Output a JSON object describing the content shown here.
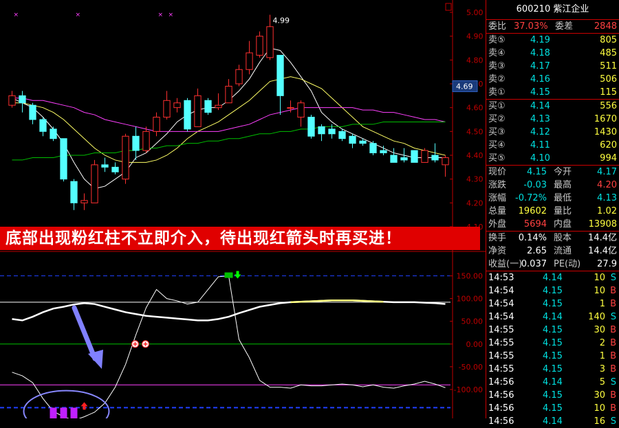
{
  "stock": {
    "code": "600210",
    "name": "紫江企业"
  },
  "banner_text": "底部出现粉红柱不立即介入，待出现红箭头时再买进！",
  "quote_top": {
    "weibi_label": "委比",
    "weibi": "37.03%",
    "weicha_label": "委差",
    "weicha": "2848"
  },
  "asks": [
    {
      "label": "卖⑤",
      "price": "4.19",
      "vol": "805"
    },
    {
      "label": "卖④",
      "price": "4.18",
      "vol": "485"
    },
    {
      "label": "卖③",
      "price": "4.17",
      "vol": "511"
    },
    {
      "label": "卖②",
      "price": "4.16",
      "vol": "506"
    },
    {
      "label": "卖①",
      "price": "4.15",
      "vol": "115"
    }
  ],
  "bids": [
    {
      "label": "买①",
      "price": "4.14",
      "vol": "556"
    },
    {
      "label": "买②",
      "price": "4.13",
      "vol": "1670"
    },
    {
      "label": "买③",
      "price": "4.12",
      "vol": "1430"
    },
    {
      "label": "买④",
      "price": "4.11",
      "vol": "620"
    },
    {
      "label": "买⑤",
      "price": "4.10",
      "vol": "994"
    }
  ],
  "stats": [
    {
      "l1": "现价",
      "v1": "4.15",
      "l2": "今开",
      "v2": "4.17"
    },
    {
      "l1": "涨跌",
      "v1": "-0.03",
      "l2": "最高",
      "v2": "4.20"
    },
    {
      "l1": "涨幅",
      "v1": "-0.72%",
      "l2": "最低",
      "v2": "4.13"
    },
    {
      "l1": "总量",
      "v1": "19602",
      "l2": "量比",
      "v2": "1.02"
    },
    {
      "l1": "外盘",
      "v1": "5694",
      "l2": "内盘",
      "v2": "13908"
    }
  ],
  "stats2": [
    {
      "l1": "换手",
      "v1": "0.14%",
      "l2": "股本",
      "v2": "14.4亿"
    },
    {
      "l1": "净资",
      "v1": "2.65",
      "l2": "流通",
      "v2": "14.4亿"
    },
    {
      "l1": "收益(一)",
      "v1": "0.037",
      "l2": "PE(动)",
      "v2": "27.9"
    }
  ],
  "ticks": [
    {
      "time": "14:53",
      "price": "4.14",
      "vol": "10",
      "side": "S"
    },
    {
      "time": "14:54",
      "price": "4.15",
      "vol": "10",
      "side": "B"
    },
    {
      "time": "14:54",
      "price": "4.15",
      "vol": "1",
      "side": "B"
    },
    {
      "time": "14:54",
      "price": "4.14",
      "vol": "140",
      "side": "S"
    },
    {
      "time": "14:55",
      "price": "4.15",
      "vol": "30",
      "side": "B"
    },
    {
      "time": "14:55",
      "price": "4.15",
      "vol": "2",
      "side": "B"
    },
    {
      "time": "14:55",
      "price": "4.15",
      "vol": "1",
      "side": "B"
    },
    {
      "time": "14:55",
      "price": "4.15",
      "vol": "3",
      "side": "B"
    },
    {
      "time": "14:56",
      "price": "4.14",
      "vol": "5",
      "side": "S"
    },
    {
      "time": "14:56",
      "price": "4.15",
      "vol": "30",
      "side": "B"
    },
    {
      "time": "14:56",
      "price": "4.15",
      "vol": "10",
      "side": "B"
    },
    {
      "time": "14:56",
      "price": "4.14",
      "vol": "16",
      "side": "S"
    }
  ],
  "colors": {
    "up": "#ff3030",
    "down": "#54ffff",
    "ma5": "#ffffff",
    "ma10": "#ffff66",
    "ma20": "#ff40ff",
    "ma60": "#00c000",
    "osc": "#ffffff",
    "grid": "#c00000"
  },
  "chart_data": [
    {
      "type": "candlestick",
      "ylim": [
        4.1,
        5.0
      ],
      "y_ticks": [
        "5.00",
        "4.90",
        "4.80",
        "4.70",
        "4.60",
        "4.50",
        "4.40",
        "4.30",
        "4.20",
        "4.10"
      ],
      "current_price_label": "4.69",
      "high_label": "4.99",
      "candles": [
        {
          "o": 4.61,
          "c": 4.65,
          "h": 4.67,
          "l": 4.6
        },
        {
          "o": 4.65,
          "c": 4.62,
          "h": 4.67,
          "l": 4.58
        },
        {
          "o": 4.61,
          "c": 4.55,
          "h": 4.62,
          "l": 4.53
        },
        {
          "o": 4.55,
          "c": 4.5,
          "h": 4.56,
          "l": 4.48
        },
        {
          "o": 4.51,
          "c": 4.47,
          "h": 4.52,
          "l": 4.46
        },
        {
          "o": 4.47,
          "c": 4.3,
          "h": 4.47,
          "l": 4.29
        },
        {
          "o": 4.29,
          "c": 4.2,
          "h": 4.3,
          "l": 4.17
        },
        {
          "o": 4.2,
          "c": 4.21,
          "h": 4.24,
          "l": 4.17
        },
        {
          "o": 4.2,
          "c": 4.36,
          "h": 4.38,
          "l": 4.2
        },
        {
          "o": 4.36,
          "c": 4.35,
          "h": 4.39,
          "l": 4.33
        },
        {
          "o": 4.35,
          "c": 4.33,
          "h": 4.37,
          "l": 4.32
        },
        {
          "o": 4.3,
          "c": 4.48,
          "h": 4.49,
          "l": 4.28
        },
        {
          "o": 4.48,
          "c": 4.42,
          "h": 4.52,
          "l": 4.38
        },
        {
          "o": 4.42,
          "c": 4.5,
          "h": 4.52,
          "l": 4.41
        },
        {
          "o": 4.5,
          "c": 4.56,
          "h": 4.58,
          "l": 4.48
        },
        {
          "o": 4.56,
          "c": 4.63,
          "h": 4.67,
          "l": 4.55
        },
        {
          "o": 4.6,
          "c": 4.62,
          "h": 4.64,
          "l": 4.58
        },
        {
          "o": 4.63,
          "c": 4.51,
          "h": 4.64,
          "l": 4.5
        },
        {
          "o": 4.52,
          "c": 4.65,
          "h": 4.68,
          "l": 4.52
        },
        {
          "o": 4.63,
          "c": 4.58,
          "h": 4.64,
          "l": 4.57
        },
        {
          "o": 4.6,
          "c": 4.61,
          "h": 4.66,
          "l": 4.59
        },
        {
          "o": 4.62,
          "c": 4.69,
          "h": 4.72,
          "l": 4.62
        },
        {
          "o": 4.7,
          "c": 4.76,
          "h": 4.78,
          "l": 4.69
        },
        {
          "o": 4.76,
          "c": 4.83,
          "h": 4.88,
          "l": 4.74
        },
        {
          "o": 4.82,
          "c": 4.9,
          "h": 4.92,
          "l": 4.81
        },
        {
          "o": 4.81,
          "c": 4.94,
          "h": 4.99,
          "l": 4.8
        },
        {
          "o": 4.82,
          "c": 4.65,
          "h": 4.82,
          "l": 4.57
        },
        {
          "o": 4.6,
          "c": 4.6,
          "h": 4.63,
          "l": 4.58
        },
        {
          "o": 4.56,
          "c": 4.62,
          "h": 4.63,
          "l": 4.52
        },
        {
          "o": 4.56,
          "c": 4.48,
          "h": 4.57,
          "l": 4.47
        },
        {
          "o": 4.52,
          "c": 4.49,
          "h": 4.53,
          "l": 4.46
        },
        {
          "o": 4.51,
          "c": 4.49,
          "h": 4.53,
          "l": 4.47
        },
        {
          "o": 4.5,
          "c": 4.47,
          "h": 4.51,
          "l": 4.46
        },
        {
          "o": 4.48,
          "c": 4.45,
          "h": 4.49,
          "l": 4.43
        },
        {
          "o": 4.46,
          "c": 4.45,
          "h": 4.47,
          "l": 4.44
        },
        {
          "o": 4.45,
          "c": 4.41,
          "h": 4.46,
          "l": 4.4
        },
        {
          "o": 4.42,
          "c": 4.41,
          "h": 4.44,
          "l": 4.4
        },
        {
          "o": 4.4,
          "c": 4.37,
          "h": 4.43,
          "l": 4.37
        },
        {
          "o": 4.39,
          "c": 4.38,
          "h": 4.43,
          "l": 4.37
        },
        {
          "o": 4.42,
          "c": 4.37,
          "h": 4.42,
          "l": 4.37
        },
        {
          "o": 4.37,
          "c": 4.42,
          "h": 4.43,
          "l": 4.37
        },
        {
          "o": 4.4,
          "c": 4.38,
          "h": 4.45,
          "l": 4.37
        },
        {
          "o": 4.36,
          "c": 4.39,
          "h": 4.4,
          "l": 4.31
        }
      ],
      "ma": [
        {
          "name": "ma5",
          "values": [
            4.64,
            4.62,
            4.6,
            4.56,
            4.51,
            4.45,
            4.37,
            4.3,
            4.26,
            4.27,
            4.3,
            4.33,
            4.39,
            4.41,
            4.45,
            4.49,
            4.54,
            4.57,
            4.59,
            4.6,
            4.6,
            4.63,
            4.67,
            4.72,
            4.79,
            4.85,
            4.84,
            4.79,
            4.73,
            4.67,
            4.58,
            4.54,
            4.51,
            4.49,
            4.47,
            4.45,
            4.43,
            4.41,
            4.4,
            4.39,
            4.39,
            4.39,
            4.39
          ]
        },
        {
          "name": "ma10",
          "values": [
            4.62,
            4.62,
            4.61,
            4.6,
            4.58,
            4.55,
            4.51,
            4.47,
            4.43,
            4.4,
            4.38,
            4.37,
            4.37,
            4.37,
            4.38,
            4.4,
            4.43,
            4.47,
            4.5,
            4.52,
            4.54,
            4.57,
            4.6,
            4.63,
            4.67,
            4.71,
            4.72,
            4.73,
            4.72,
            4.7,
            4.68,
            4.64,
            4.6,
            4.56,
            4.52,
            4.5,
            4.48,
            4.46,
            4.45,
            4.43,
            4.42,
            4.41,
            4.4
          ]
        },
        {
          "name": "ma20",
          "values": [
            4.64,
            4.64,
            4.63,
            4.63,
            4.62,
            4.61,
            4.6,
            4.58,
            4.57,
            4.55,
            4.54,
            4.53,
            4.52,
            4.51,
            4.5,
            4.5,
            4.5,
            4.5,
            4.5,
            4.5,
            4.5,
            4.51,
            4.52,
            4.53,
            4.55,
            4.57,
            4.58,
            4.59,
            4.6,
            4.6,
            4.6,
            4.6,
            4.6,
            4.6,
            4.59,
            4.59,
            4.58,
            4.58,
            4.57,
            4.56,
            4.55,
            4.55,
            4.54
          ]
        },
        {
          "name": "ma60",
          "values": [
            4.38,
            4.38,
            4.39,
            4.39,
            4.39,
            4.4,
            4.4,
            4.4,
            4.41,
            4.41,
            4.41,
            4.42,
            4.42,
            4.43,
            4.43,
            4.44,
            4.44,
            4.45,
            4.45,
            4.46,
            4.46,
            4.47,
            4.47,
            4.48,
            4.49,
            4.49,
            4.5,
            4.5,
            4.51,
            4.51,
            4.52,
            4.52,
            4.52,
            4.53,
            4.53,
            4.53,
            4.54,
            4.54,
            4.54,
            4.54,
            4.54,
            4.54,
            4.54
          ]
        }
      ]
    },
    {
      "type": "line",
      "ylim": [
        -150,
        175
      ],
      "y_ticks": [
        "150.00",
        "100.00",
        "50.00",
        "0.00",
        "-50.00",
        "-100.00"
      ],
      "series": [
        {
          "values": [
            -62,
            -70,
            -85,
            -120,
            -148,
            -160,
            -168,
            -160,
            -150,
            -130,
            -95,
            -45,
            20,
            80,
            120,
            100,
            95,
            88,
            92,
            120,
            148,
            150,
            10,
            -30,
            -80,
            -95,
            -95,
            -97,
            -90,
            -92,
            -92,
            -90,
            -88,
            -90,
            -94,
            -90,
            -95,
            -97,
            -92,
            -88,
            -82,
            -88,
            -96
          ]
        },
        {
          "values": [
            55,
            52,
            60,
            70,
            78,
            82,
            87,
            90,
            88,
            82,
            76,
            70,
            66,
            62,
            60,
            58,
            56,
            54,
            52,
            52,
            55,
            60,
            68,
            75,
            82,
            86,
            90,
            92,
            93,
            94,
            95,
            96,
            96,
            96,
            95,
            94,
            93,
            92,
            92,
            92,
            91,
            90,
            88
          ]
        }
      ],
      "ref_lines": [
        150,
        92,
        0,
        -90,
        -140
      ],
      "bars": [
        {
          "i": 4,
          "v": -168
        },
        {
          "i": 5,
          "v": -180
        },
        {
          "i": 6,
          "v": -162
        }
      ]
    }
  ]
}
